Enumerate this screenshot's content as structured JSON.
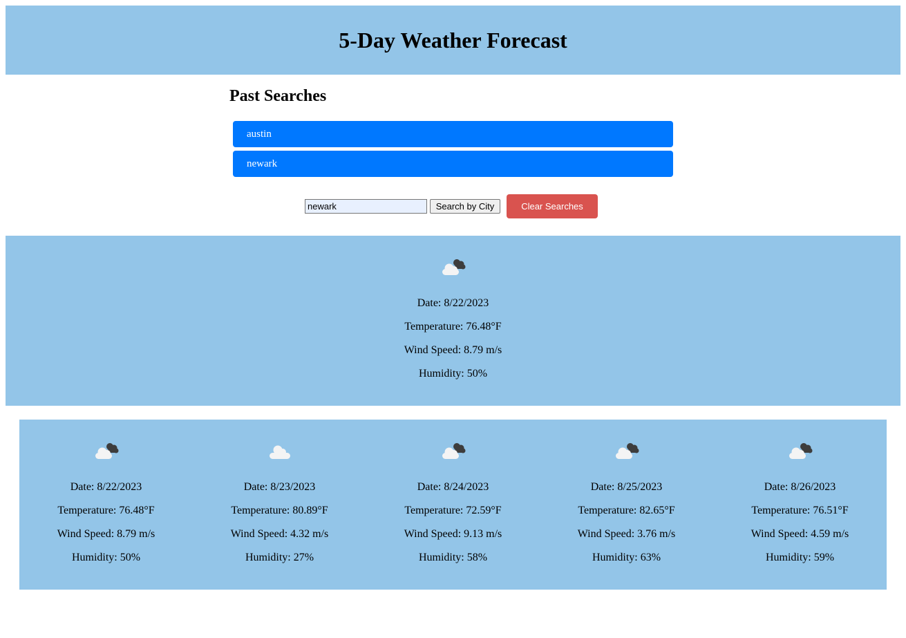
{
  "header": {
    "title": "5-Day Weather Forecast"
  },
  "past_searches": {
    "title": "Past Searches",
    "items": [
      "austin",
      "newark"
    ]
  },
  "search": {
    "value": "newark",
    "button_label": "Search by City",
    "clear_label": "Clear Searches"
  },
  "current": {
    "icon": "cloudy-icon",
    "date": "Date: 8/22/2023",
    "temperature": "Temperature: 76.48°F",
    "wind": "Wind Speed: 8.79 m/s",
    "humidity": "Humidity: 50%"
  },
  "forecast": [
    {
      "icon": "cloudy-icon",
      "date": "Date: 8/22/2023",
      "temperature": "Temperature: 76.48°F",
      "wind": "Wind Speed: 8.79 m/s",
      "humidity": "Humidity: 50%"
    },
    {
      "icon": "cloud-icon",
      "date": "Date: 8/23/2023",
      "temperature": "Temperature: 80.89°F",
      "wind": "Wind Speed: 4.32 m/s",
      "humidity": "Humidity: 27%"
    },
    {
      "icon": "cloudy-icon",
      "date": "Date: 8/24/2023",
      "temperature": "Temperature: 72.59°F",
      "wind": "Wind Speed: 9.13 m/s",
      "humidity": "Humidity: 58%"
    },
    {
      "icon": "cloudy-icon",
      "date": "Date: 8/25/2023",
      "temperature": "Temperature: 82.65°F",
      "wind": "Wind Speed: 3.76 m/s",
      "humidity": "Humidity: 63%"
    },
    {
      "icon": "cloudy-icon",
      "date": "Date: 8/26/2023",
      "temperature": "Temperature: 76.51°F",
      "wind": "Wind Speed: 4.59 m/s",
      "humidity": "Humidity: 59%"
    }
  ],
  "colors": {
    "panel": "#93c5e8",
    "history_button": "#0078ff",
    "clear_button": "#d9534f"
  }
}
